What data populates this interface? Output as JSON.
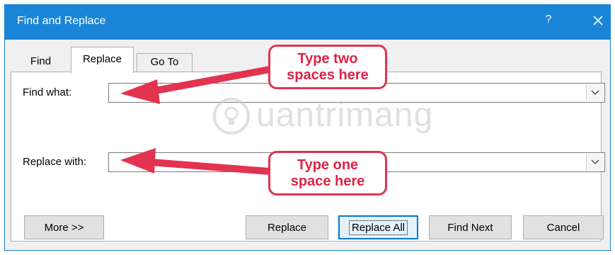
{
  "window": {
    "title": "Find and Replace",
    "help_label": "?",
    "close_icon": "close-icon"
  },
  "tabs": [
    {
      "label": "Find",
      "active": false
    },
    {
      "label": "Replace",
      "active": true
    },
    {
      "label": "Go To",
      "active": false
    }
  ],
  "find": {
    "label": "Find what:",
    "value": ""
  },
  "replace": {
    "label": "Replace with:",
    "value": ""
  },
  "buttons": {
    "more": "More >>",
    "replace": "Replace",
    "replace_all": "Replace All",
    "find_next": "Find Next",
    "cancel": "Cancel"
  },
  "callouts": {
    "find_line1": "Type two",
    "find_line2": "spaces here",
    "replace_line1": "Type one",
    "replace_line2": "space here"
  },
  "watermark": {
    "text": "uantrimang"
  },
  "colors": {
    "titlebar": "#1a84d7",
    "callout": "#e23350",
    "focus_border": "#0078d7"
  }
}
